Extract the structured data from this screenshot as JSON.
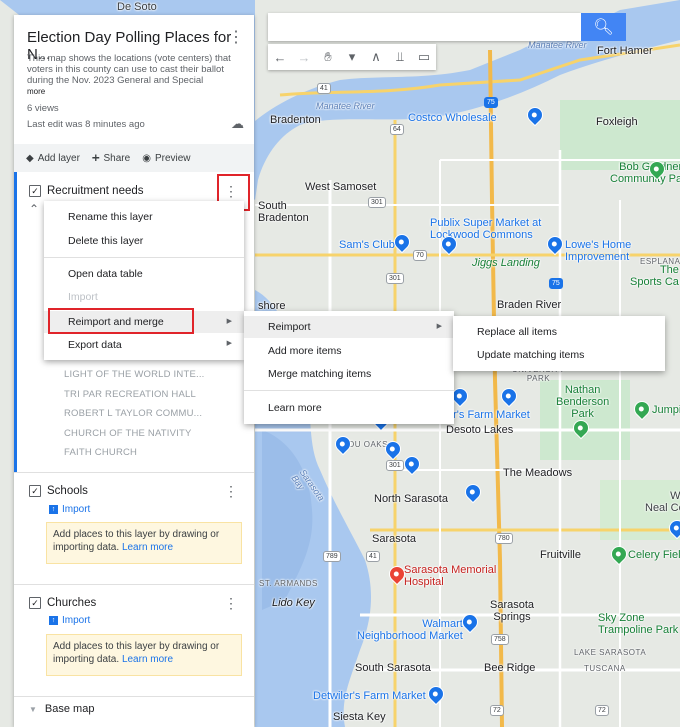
{
  "search": {
    "placeholder": "",
    "button_icon": "search-icon"
  },
  "toolbar": {
    "icons": [
      "undo-icon",
      "redo-icon",
      "hand-icon",
      "marker-icon",
      "line-icon",
      "filter-icon",
      "ruler-icon"
    ]
  },
  "map": {
    "labels": {
      "de_soto": "De Soto",
      "fort_hamer": "Fort Hamer",
      "manatee_river_top": "Manatee River",
      "manatee_river": "Manatee River",
      "bradenton": "Bradenton",
      "costco": "Costco Wholesale",
      "foxleigh": "Foxleigh",
      "bob_gardner": "Bob Gardner\nCommunity Park",
      "west_samoset": "West Samoset",
      "south_bradenton": "South\nBradenton",
      "publix": "Publix Super Market at\nLockwood Commons",
      "sams_club": "Sam's Club",
      "lowes": "Lowe's Home\nImprovement",
      "jiggs_landing": "Jiggs Landing",
      "esplanade": "ESPLANA",
      "sports_ca": "The\nSports Ca",
      "shore": "shore",
      "braden_river": "Braden River",
      "university_park": "UNIVERSITY\nPARK",
      "nathan_benderson": "Nathan\nBenderson\nPark",
      "jumpi": "Jumpi",
      "detwilers_1": "etwiler's Farm Market",
      "desoto_lakes": "Desoto Lakes",
      "ou_oaks": "OU OAKS",
      "the_meadows": "The Meadows",
      "sarasota_bay": "Sarasota\nBay",
      "north_sarasota": "North Sarasota",
      "windw": "Windw\nNeal Comm",
      "sarasota": "Sarasota",
      "fruitville": "Fruitville",
      "celery_field": "Celery Fiel",
      "sarasota_memorial": "Sarasota Memorial\nHospital",
      "st_armands": "ST. ARMANDS",
      "lido_key": "Lido Key",
      "sarasota_springs": "Sarasota\nSprings",
      "walmart": "Walmart\nNeighborhood Market",
      "sky_zone": "Sky Zone\nTrampoline Park",
      "lake_sarasota": "LAKE SARASOTA",
      "tuscana": "TUSCANA",
      "south_sarasota": "South Sarasota",
      "bee_ridge": "Bee Ridge",
      "detwilers_2": "Detwiler's Farm Market",
      "siesta_key": "Siesta Key"
    },
    "shields": [
      "41",
      "75",
      "64",
      "301",
      "70",
      "75",
      "301",
      "301",
      "780",
      "789",
      "41",
      "758",
      "72",
      "72"
    ]
  },
  "panel": {
    "title": "Election Day Polling Places for N...",
    "description": "This map shows the locations (vote centers) that voters in this county can use to cast their ballot during the Nov. 2023 General and Special",
    "more": "more",
    "views": "6 views",
    "last_edit": "Last edit was 8 minutes ago",
    "actions": {
      "add_layer": "Add layer",
      "share": "Share",
      "preview": "Preview"
    },
    "layers": [
      {
        "name": "Recruitment needs",
        "items": [
          "LIGHT OF THE WORLD INTE...",
          "TRI PAR RECREATION HALL",
          "ROBERT L TAYLOR COMMU...",
          "CHURCH OF THE NATIVITY",
          "FAITH CHURCH"
        ]
      },
      {
        "name": "Schools",
        "import": "Import",
        "hint": "Add places to this layer by drawing or importing data.",
        "learn_more": "Learn more"
      },
      {
        "name": "Churches",
        "import": "Import",
        "hint": "Add places to this layer by drawing or importing data.",
        "learn_more": "Learn more"
      }
    ],
    "base_map": "Base map"
  },
  "layer_menu": {
    "rename": "Rename this layer",
    "delete": "Delete this layer",
    "open_table": "Open data table",
    "import": "Import",
    "reimport_merge": "Reimport and merge",
    "export": "Export data"
  },
  "reimport_menu": {
    "reimport": "Reimport",
    "add_more": "Add more items",
    "merge_matching": "Merge matching items",
    "learn_more": "Learn more"
  },
  "reimport_submenu": {
    "replace_all": "Replace all items",
    "update_matching": "Update matching items"
  },
  "colors": {
    "accent": "#1a73e8",
    "highlight_box": "#e0242a",
    "hint_bg": "#fef7e0"
  }
}
